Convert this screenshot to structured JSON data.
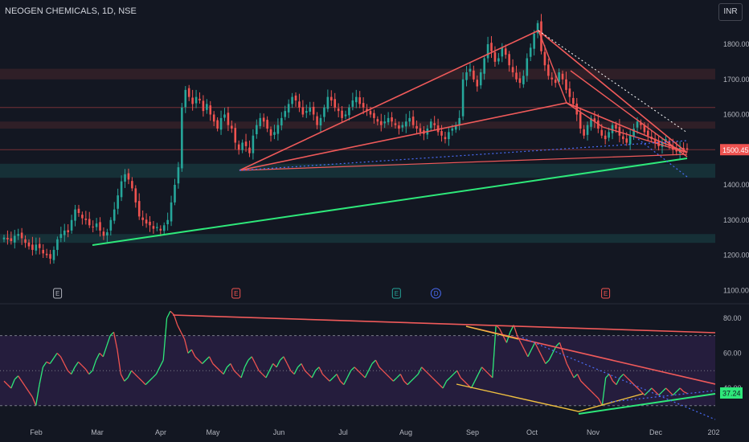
{
  "header": {
    "title": "NEOGEN CHEMICALS, 1D, NSE",
    "currency": "INR"
  },
  "colors": {
    "up": "#26a69a",
    "down": "#ef5350",
    "background": "#131722",
    "trend_red": "#f05a5a",
    "trend_green": "#2ee87a",
    "rsi_line_up": "#2ee87a",
    "rsi_line_down": "#ef5350",
    "rsi_band": "#2a1f45",
    "yellow": "#f0c040"
  },
  "chart_data": [
    {
      "type": "candlestick",
      "title": "NEOGEN CHEMICALS, 1D, NSE",
      "x_ticks": [
        "Feb",
        "Mar",
        "Apr",
        "May",
        "Jun",
        "Jul",
        "Aug",
        "Sep",
        "Oct",
        "Nov",
        "Dec",
        "202"
      ],
      "y_ticks": [
        1100,
        1200,
        1300,
        1400,
        1500,
        1600,
        1700,
        1800
      ],
      "ylim": [
        1080,
        1880
      ],
      "last_price": "1500.45",
      "events": [
        {
          "label": "E",
          "month_index": 0.35,
          "style": "neutral"
        },
        {
          "label": "E",
          "month_index": 3.35,
          "style": "red"
        },
        {
          "label": "E",
          "month_index": 5.85,
          "style": "green"
        },
        {
          "label": "D",
          "month_index": 6.45,
          "style": "blue"
        },
        {
          "label": "E",
          "month_index": 9.2,
          "style": "red"
        }
      ],
      "series_close": [
        1250,
        1245,
        1240,
        1255,
        1260,
        1248,
        1235,
        1225,
        1215,
        1230,
        1220,
        1205,
        1200,
        1190,
        1215,
        1245,
        1260,
        1270,
        1265,
        1300,
        1330,
        1320,
        1305,
        1300,
        1285,
        1280,
        1290,
        1270,
        1255,
        1265,
        1300,
        1330,
        1370,
        1410,
        1430,
        1415,
        1390,
        1350,
        1310,
        1300,
        1290,
        1285,
        1275,
        1280,
        1270,
        1285,
        1300,
        1350,
        1400,
        1450,
        1620,
        1670,
        1650,
        1630,
        1650,
        1640,
        1610,
        1630,
        1600,
        1580,
        1560,
        1590,
        1600,
        1570,
        1560,
        1520,
        1500,
        1520,
        1510,
        1490,
        1540,
        1570,
        1590,
        1580,
        1560,
        1540,
        1550,
        1570,
        1590,
        1610,
        1630,
        1650,
        1640,
        1620,
        1600,
        1610,
        1620,
        1600,
        1570,
        1590,
        1620,
        1650,
        1640,
        1620,
        1610,
        1590,
        1600,
        1620,
        1640,
        1650,
        1630,
        1620,
        1610,
        1600,
        1590,
        1580,
        1570,
        1580,
        1590,
        1580,
        1570,
        1560,
        1570,
        1580,
        1590,
        1570,
        1560,
        1550,
        1545,
        1560,
        1580,
        1570,
        1550,
        1540,
        1530,
        1550,
        1560,
        1570,
        1590,
        1700,
        1720,
        1730,
        1700,
        1680,
        1720,
        1760,
        1800,
        1780,
        1750,
        1760,
        1790,
        1770,
        1740,
        1720,
        1700,
        1690,
        1710,
        1760,
        1790,
        1830,
        1860,
        1780,
        1740,
        1710,
        1700,
        1690,
        1720,
        1700,
        1670,
        1650,
        1630,
        1600,
        1560,
        1540,
        1570,
        1590,
        1580,
        1560,
        1540,
        1530,
        1550,
        1570,
        1560,
        1540,
        1530,
        1520,
        1540,
        1560,
        1580,
        1570,
        1550,
        1540,
        1530,
        1520,
        1510,
        1520,
        1530,
        1510,
        1500,
        1495,
        1505,
        1500,
        1500
      ]
    },
    {
      "type": "line",
      "title": "",
      "y_ticks": [
        40,
        60,
        80
      ],
      "ylim": [
        23,
        85
      ],
      "overbought": 70,
      "oversold": 30,
      "mid": 50,
      "last_value": "37.24",
      "values": [
        44,
        42,
        40,
        45,
        47,
        44,
        41,
        38,
        35,
        30,
        42,
        52,
        55,
        54,
        57,
        60,
        58,
        54,
        50,
        48,
        52,
        55,
        53,
        51,
        48,
        50,
        56,
        60,
        58,
        64,
        70,
        72,
        62,
        48,
        44,
        46,
        50,
        48,
        46,
        44,
        42,
        44,
        46,
        48,
        52,
        56,
        80,
        84,
        82,
        76,
        72,
        68,
        60,
        62,
        58,
        56,
        54,
        56,
        58,
        54,
        52,
        50,
        48,
        52,
        54,
        50,
        48,
        46,
        52,
        56,
        58,
        54,
        50,
        48,
        46,
        50,
        54,
        52,
        56,
        58,
        54,
        50,
        48,
        52,
        54,
        50,
        48,
        46,
        50,
        52,
        48,
        46,
        44,
        46,
        48,
        44,
        42,
        46,
        50,
        52,
        50,
        48,
        46,
        50,
        54,
        56,
        52,
        50,
        48,
        46,
        44,
        46,
        48,
        44,
        42,
        44,
        46,
        48,
        52,
        50,
        48,
        46,
        44,
        42,
        40,
        44,
        46,
        48,
        50,
        46,
        44,
        42,
        40,
        44,
        48,
        52,
        50,
        48,
        46,
        76,
        74,
        70,
        66,
        72,
        76,
        70,
        66,
        62,
        58,
        62,
        66,
        62,
        58,
        54,
        56,
        60,
        64,
        66,
        60,
        54,
        50,
        46,
        48,
        44,
        42,
        40,
        38,
        36,
        34,
        30,
        46,
        48,
        44,
        42,
        46,
        48,
        46,
        44,
        42,
        40,
        38,
        36,
        38,
        40,
        38,
        36,
        38,
        40,
        38,
        36,
        38,
        40,
        38,
        37
      ]
    }
  ]
}
